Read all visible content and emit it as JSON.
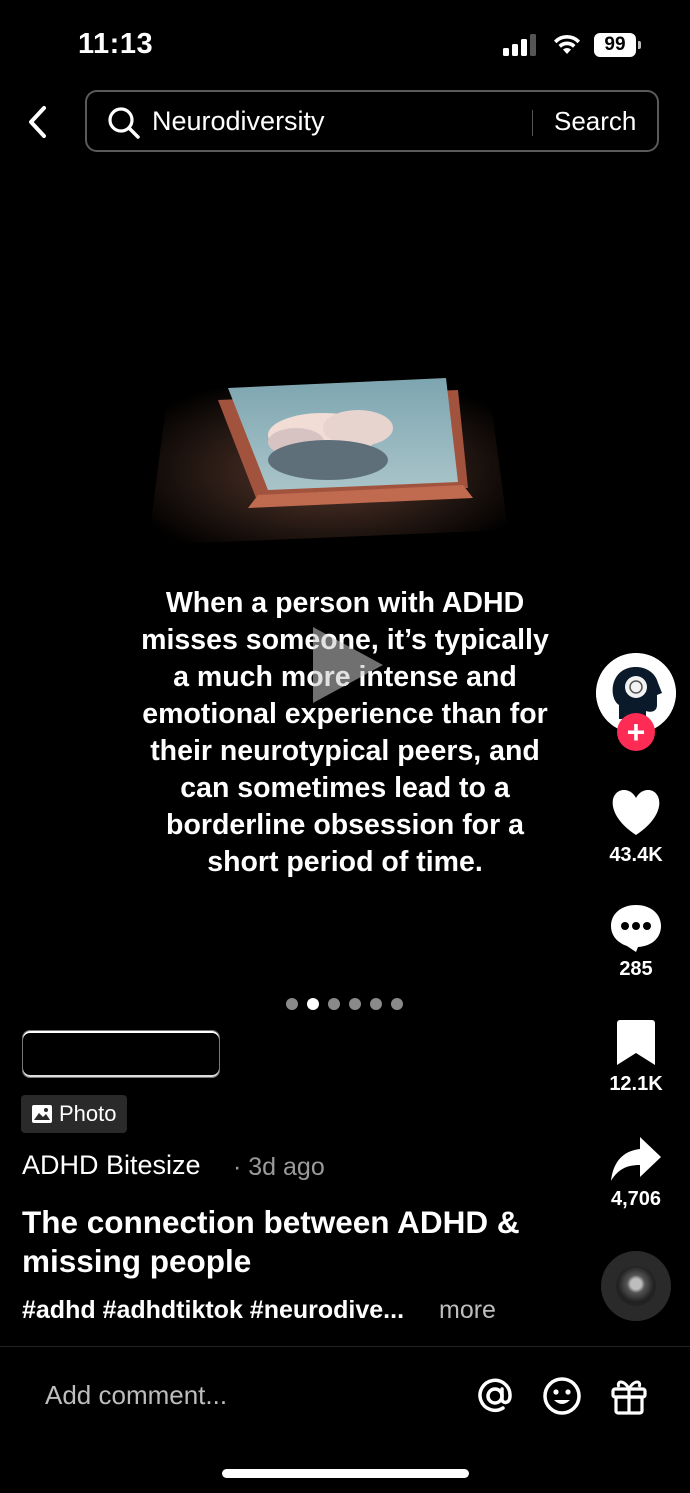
{
  "status_bar": {
    "time": "11:13",
    "battery": "99"
  },
  "search": {
    "query": "Neurodiversity",
    "button_label": "Search"
  },
  "post": {
    "caption": "When a person with ADHD misses someone, it’s typically a much more intense and emotional experience than for their neurotypical peers, and can sometimes lead to a borderline obsession for a short period of time.",
    "slide_count": 6,
    "active_slide": 2,
    "type_label": "Photo",
    "author": "ADHD Bitesize",
    "age": "· 3d ago",
    "title": "The connection between ADHD & missing people",
    "hashtags": "#adhd #adhdtiktok #neurodive...",
    "more_label": "more"
  },
  "actions": {
    "likes": "43.4K",
    "comments": "285",
    "saves": "12.1K",
    "shares": "4,706"
  },
  "comment_bar": {
    "placeholder": "Add comment..."
  },
  "icons": [
    "back-icon",
    "search-icon",
    "heart-icon",
    "comment-icon",
    "bookmark-icon",
    "share-icon",
    "at-icon",
    "emoji-icon",
    "gift-icon",
    "photo-icon",
    "play-icon"
  ],
  "colors": {
    "background": "#000000",
    "accent": "#fe2c55"
  }
}
